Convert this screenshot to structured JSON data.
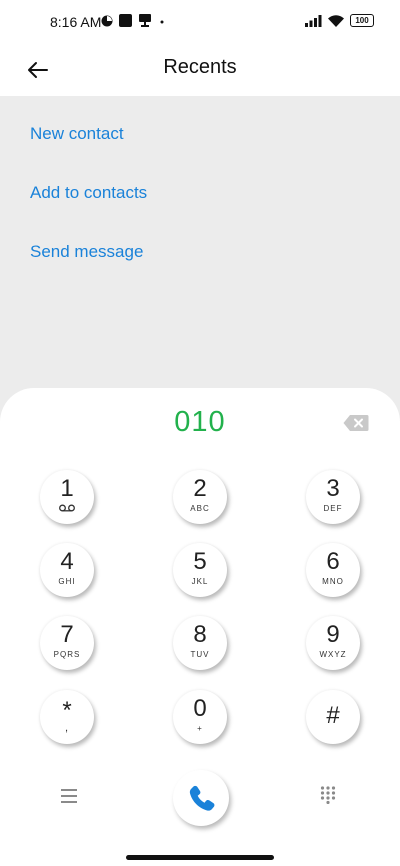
{
  "status": {
    "time": "8:16 AM",
    "battery": "100"
  },
  "header": {
    "title": "Recents"
  },
  "actions": [
    {
      "label": "New contact"
    },
    {
      "label": "Add to contacts"
    },
    {
      "label": "Send message"
    }
  ],
  "dialer": {
    "number": "010",
    "keys": [
      {
        "digit": "1",
        "letters": "",
        "sub_icon": "voicemail-icon"
      },
      {
        "digit": "2",
        "letters": "ABC"
      },
      {
        "digit": "3",
        "letters": "DEF"
      },
      {
        "digit": "4",
        "letters": "GHI"
      },
      {
        "digit": "5",
        "letters": "JKL"
      },
      {
        "digit": "6",
        "letters": "MNO"
      },
      {
        "digit": "7",
        "letters": "PQRS"
      },
      {
        "digit": "8",
        "letters": "TUV"
      },
      {
        "digit": "9",
        "letters": "WXYZ"
      },
      {
        "digit": "*",
        "letters": ","
      },
      {
        "digit": "0",
        "letters": "+"
      },
      {
        "digit": "#",
        "letters": ""
      }
    ]
  },
  "colors": {
    "accent": "#1a82d9",
    "number": "#22b14c",
    "call": "#1a82d9"
  }
}
